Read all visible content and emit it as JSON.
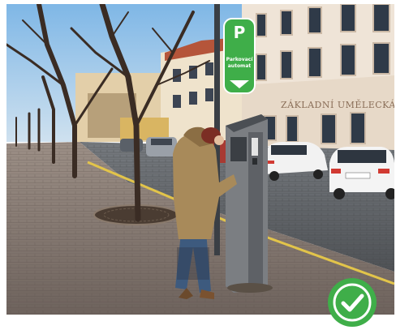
{
  "sign": {
    "letter": "P",
    "line1": "Parkovací",
    "line2": "automat"
  },
  "building": {
    "facade_text": "ZÁKLADNÍ UMĚLECKÁ ŠKOLA"
  },
  "badge": {
    "icon": "checkmark-icon",
    "color": "#3fae49"
  }
}
